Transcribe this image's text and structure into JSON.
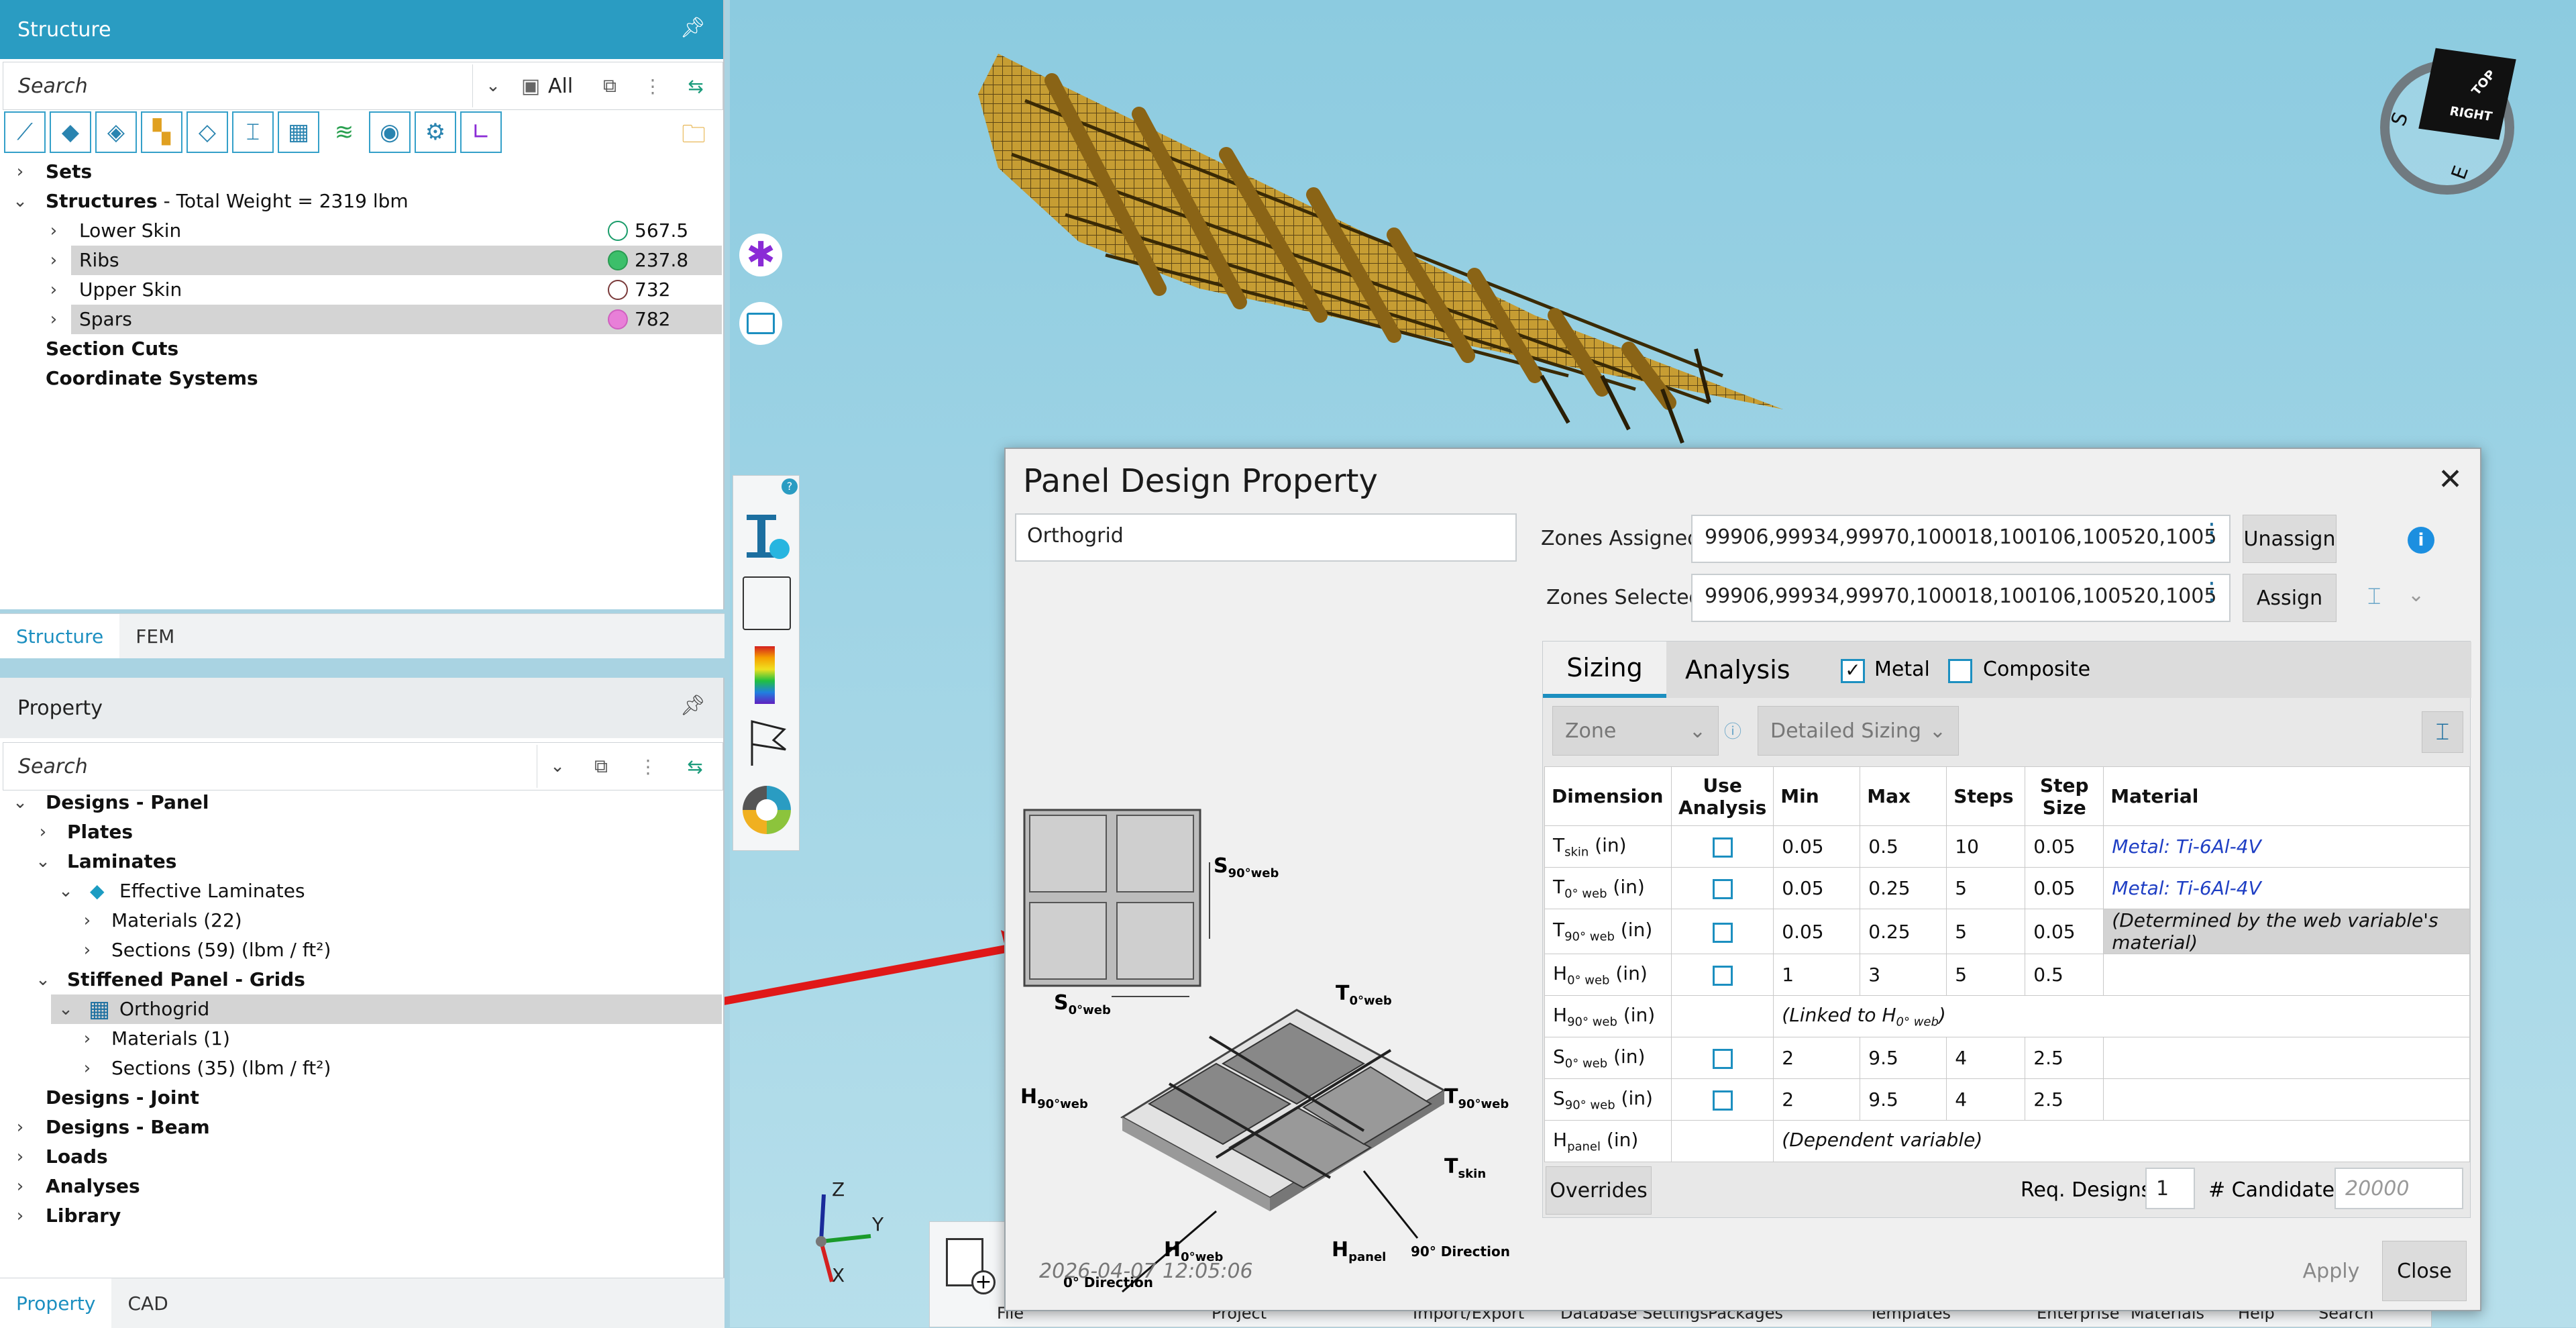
{
  "structure_panel": {
    "title": "Structure",
    "search_placeholder": "Search",
    "filter_all": "All",
    "tree": {
      "sets": "Sets",
      "structures_label": "Structures",
      "structures_weight": " - Total Weight = 2319 lbm",
      "children": [
        {
          "label": "Lower Skin",
          "value": "567.5",
          "dot_color": "#ffffff",
          "selected": false
        },
        {
          "label": "Ribs",
          "value": "237.8",
          "dot_color": "#3cbf6a",
          "selected": true
        },
        {
          "label": "Upper Skin",
          "value": "732",
          "dot_color": "#ffffff",
          "selected": false
        },
        {
          "label": "Spars",
          "value": "782",
          "dot_color": "#e87fd8",
          "selected": true
        }
      ],
      "section_cuts": "Section Cuts",
      "coordinate_systems": "Coordinate Systems"
    },
    "tabs": [
      "Structure",
      "FEM"
    ]
  },
  "property_panel": {
    "title": "Property",
    "search_placeholder": "Search",
    "tree": {
      "designs_panel": "Designs - Panel",
      "plates": "Plates",
      "laminates": "Laminates",
      "effective_laminates": "Effective Laminates",
      "materials_22": "Materials (22)",
      "sections_59": "Sections (59) (lbm / ft²)",
      "stiffened_grids": "Stiffened Panel - Grids",
      "orthogrid": "Orthogrid",
      "materials_1": "Materials (1)",
      "sections_35": "Sections (35) (lbm / ft²)",
      "designs_joint": "Designs - Joint",
      "designs_beam": "Designs - Beam",
      "loads": "Loads",
      "analyses": "Analyses",
      "library": "Library"
    },
    "tabs": [
      "Property",
      "CAD"
    ]
  },
  "viewcube": {
    "top": "TOP",
    "right": "RIGHT",
    "s": "S",
    "e": "E"
  },
  "triad": {
    "x": "X",
    "y": "Y",
    "z": "Z"
  },
  "bottom_menu": [
    "File",
    "Project",
    "Import/Export",
    "Database Settings",
    "Packages",
    "Templates",
    "Enterprise",
    "Materials",
    "Help",
    "Search"
  ],
  "dialog": {
    "title": "Panel Design Property",
    "name_value": "Orthogrid",
    "zones_assigned_label": "Zones Assigned:",
    "zones_assigned_value": "99906,99934,99970,100018,100106,100520,1005",
    "zones_selected_label": "Zones Selected:",
    "zones_selected_value": "99906,99934,99970,100018,100106,100520,1005",
    "unassign_label": "Unassign",
    "assign_label": "Assign",
    "tabs": [
      "Sizing",
      "Analysis"
    ],
    "metal_label": "Metal",
    "metal_checked": true,
    "composite_label": "Composite",
    "composite_checked": false,
    "zone_dropdown": "Zone",
    "sizing_dropdown": "Detailed Sizing",
    "table_headers": {
      "dimension": "Dimension",
      "use_analysis": "Use Analysis",
      "min": "Min",
      "max": "Max",
      "steps": "Steps",
      "step_size": "Step Size",
      "material": "Material"
    },
    "rows": [
      {
        "dim": "T",
        "sub": "skin",
        "unit": " (in)",
        "check": true,
        "min": "0.05",
        "max": "0.5",
        "steps": "10",
        "step": "0.05",
        "material": "Metal: Ti-6Al-4V",
        "mat_type": "link"
      },
      {
        "dim": "T",
        "sub": "0° web",
        "unit": " (in)",
        "check": true,
        "min": "0.05",
        "max": "0.25",
        "steps": "5",
        "step": "0.05",
        "material": "Metal: Ti-6Al-4V",
        "mat_type": "link"
      },
      {
        "dim": "T",
        "sub": "90° web",
        "unit": " (in)",
        "check": true,
        "min": "0.05",
        "max": "0.25",
        "steps": "5",
        "step": "0.05",
        "material": "(Determined by the web variable's material)",
        "mat_type": "note"
      },
      {
        "dim": "H",
        "sub": "0° web",
        "unit": " (in)",
        "check": true,
        "min": "1",
        "max": "3",
        "steps": "5",
        "step": "0.5",
        "material": "",
        "mat_type": ""
      },
      {
        "dim": "H",
        "sub": "90° web",
        "unit": " (in)",
        "check": false,
        "span": "(Linked to H",
        "span_sub": "0° web",
        "span_end": ")"
      },
      {
        "dim": "S",
        "sub": "0° web",
        "unit": " (in)",
        "check": true,
        "min": "2",
        "max": "9.5",
        "steps": "4",
        "step": "2.5",
        "material": "",
        "mat_type": ""
      },
      {
        "dim": "S",
        "sub": "90° web",
        "unit": " (in)",
        "check": true,
        "min": "2",
        "max": "9.5",
        "steps": "4",
        "step": "2.5",
        "material": "",
        "mat_type": ""
      },
      {
        "dim": "H",
        "sub": "panel",
        "unit": " (in)",
        "check": false,
        "span": "(Dependent variable)",
        "span_sub": "",
        "span_end": ""
      }
    ],
    "overrides_label": "Overrides",
    "req_designs_label": "Req. Designs",
    "req_designs_value": "1",
    "candidates_label": "# Candidates",
    "candidates_placeholder": "20000",
    "timestamp": "2026-04-07 12:05:06",
    "apply_label": "Apply",
    "close_label": "Close",
    "diagram": {
      "s90": "S",
      "s90_sub": "90°web",
      "s0": "S",
      "s0_sub": "0°web",
      "t0": "T",
      "t0_sub": "0°web",
      "t90": "T",
      "t90_sub": "90°web",
      "h90": "H",
      "h90_sub": "90°web",
      "tskin": "T",
      "tskin_sub": "skin",
      "h0": "H",
      "h0_sub": "0°web",
      "hpanel": "H",
      "hpanel_sub": "panel",
      "dir0": "0° Direction",
      "dir90": "90° Direction"
    }
  }
}
